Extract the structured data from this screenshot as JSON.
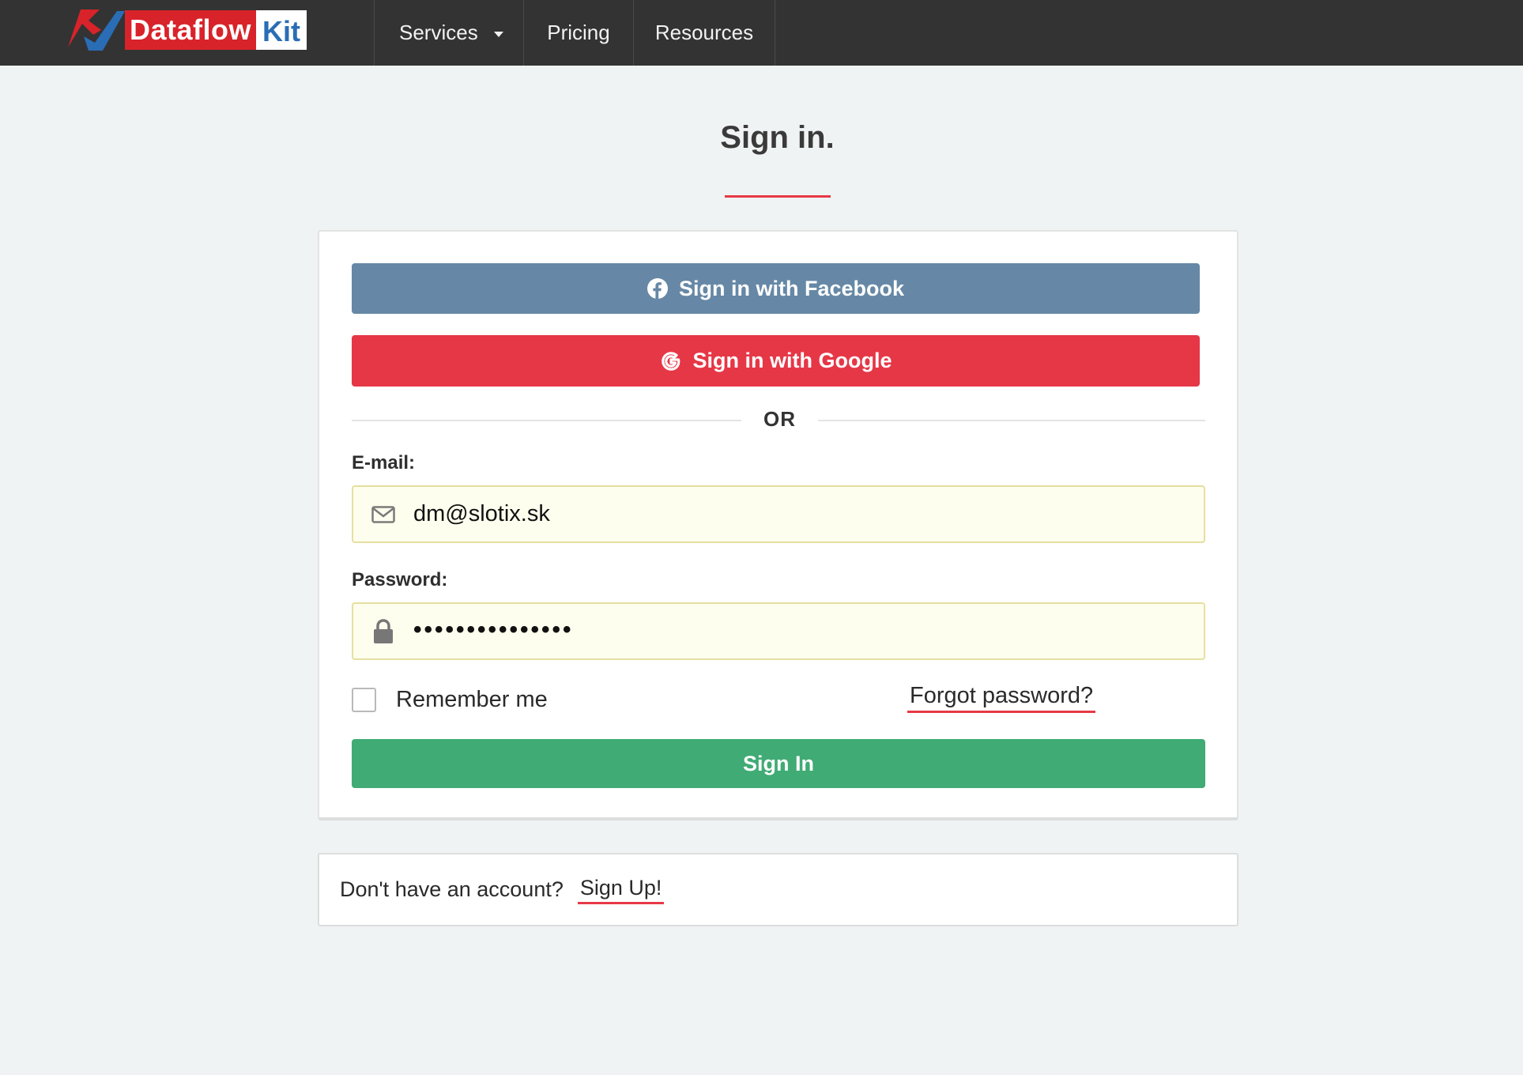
{
  "brand": {
    "logo_text": "Dataflow",
    "logo_suffix": "Kit",
    "colors": {
      "red": "#d8232a",
      "blue": "#2a6db5"
    }
  },
  "nav": {
    "items": [
      {
        "label": "Services",
        "has_dropdown": true,
        "icon": "caret-down-icon"
      },
      {
        "label": "Pricing"
      },
      {
        "label": "Resources"
      }
    ]
  },
  "page": {
    "title": "Sign in.",
    "accent_color": "#e63946"
  },
  "social": {
    "facebook_label": "Sign in with Facebook",
    "facebook_icon": "facebook-icon",
    "facebook_color": "#6688a6",
    "google_label": "Sign in with Google",
    "google_icon": "google-icon",
    "google_color": "#e63747"
  },
  "divider": {
    "text": "OR"
  },
  "form": {
    "email_label": "E-mail:",
    "email_value": "dm@slotix.sk",
    "email_icon": "envelope-icon",
    "password_label": "Password:",
    "password_value": "•••••••••••••••",
    "password_icon": "lock-icon",
    "remember_label": "Remember me",
    "remember_checked": false,
    "forgot_label": "Forgot password?",
    "submit_label": "Sign In",
    "submit_color": "#40ab75"
  },
  "signup": {
    "prompt": "Don't have an account?",
    "link_label": "Sign Up!"
  }
}
